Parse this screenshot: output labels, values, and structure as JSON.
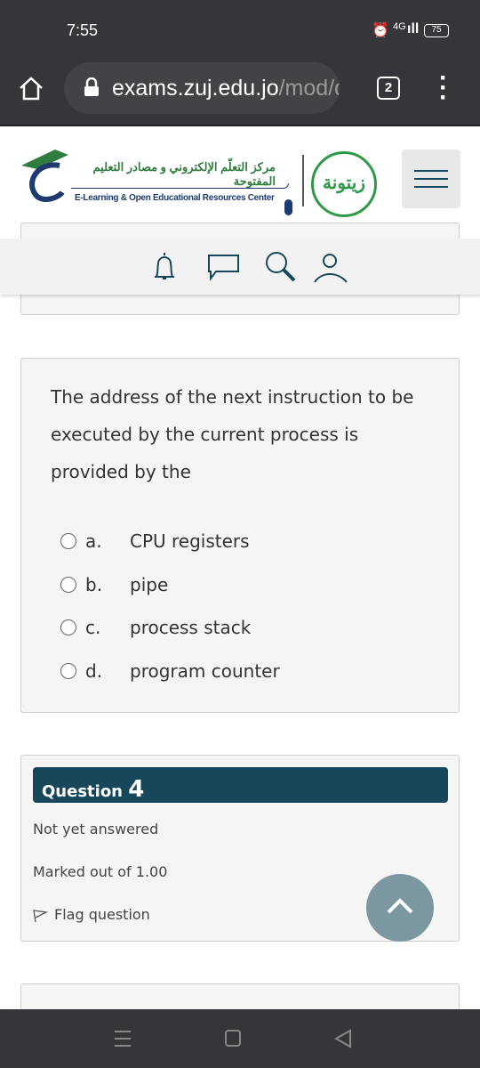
{
  "status": {
    "time": "7:55",
    "network": "4G",
    "battery": "75"
  },
  "browser": {
    "url_host": "exams.zuj.edu.jo",
    "url_path": "/mod/q",
    "tab_count": "2"
  },
  "header": {
    "logo_arabic": "مركز التعلّم الإلكتروني و مصادر التعليم المفتوحة",
    "logo_english": "E-Learning & Open Educational Resources Center"
  },
  "question3": {
    "text": "The address of the next instruction to be executed by the current process is provided by the",
    "options": [
      {
        "letter": "a.",
        "label": "CPU registers"
      },
      {
        "letter": "b.",
        "label": "pipe"
      },
      {
        "letter": "c.",
        "label": "process stack"
      },
      {
        "letter": "d.",
        "label": "program counter"
      }
    ]
  },
  "question4": {
    "label": "Question",
    "number": "4",
    "state": "Not yet answered",
    "marks": "Marked out of 1.00",
    "flag": "Flag question"
  },
  "colors": {
    "question_header": "#17475a",
    "scroll_top": "#7b98a1",
    "chrome": "#35363a"
  }
}
